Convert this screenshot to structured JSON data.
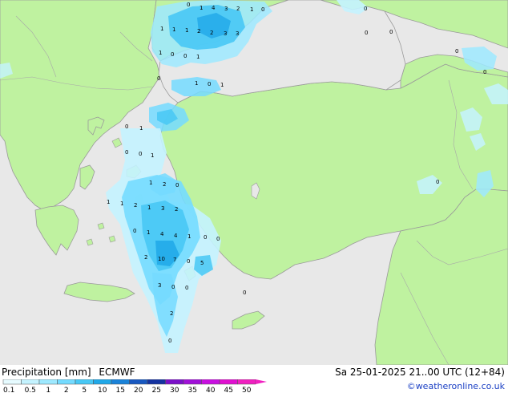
{
  "title": {
    "label": "Precipitation [mm]",
    "model": "ECMWF"
  },
  "valid_time": "Sa 25-01-2025 21..00 UTC (12+84)",
  "credit": "©weatheronline.co.uk",
  "legend": {
    "ticks": [
      "0.1",
      "0.5",
      "1",
      "2",
      "5",
      "10",
      "15",
      "20",
      "25",
      "30",
      "35",
      "40",
      "45",
      "50"
    ],
    "colors": [
      "#e6fbff",
      "#c4f3ff",
      "#9ee9ff",
      "#74dbff",
      "#48c8f5",
      "#20a8e8",
      "#1a82d8",
      "#1858c0",
      "#1432a0",
      "#7b10c8",
      "#a010d8",
      "#c810e0",
      "#e010d0",
      "#f020c0"
    ]
  },
  "colors": {
    "land": "#bff2a0",
    "sea": "#e8e8e8",
    "coast": "#9a9a9a",
    "border": "#a8a8a8"
  },
  "labels": [
    {
      "id": "v1",
      "text": "0"
    },
    {
      "id": "v2",
      "text": "1"
    },
    {
      "id": "v3",
      "text": "4"
    },
    {
      "id": "v4",
      "text": "3"
    },
    {
      "id": "v5",
      "text": "2"
    },
    {
      "id": "v6",
      "text": "1"
    },
    {
      "id": "v7",
      "text": "0"
    },
    {
      "id": "v8",
      "text": "1"
    },
    {
      "id": "v9",
      "text": "1"
    },
    {
      "id": "v10",
      "text": "1"
    },
    {
      "id": "v11",
      "text": "2"
    },
    {
      "id": "v12",
      "text": "2"
    },
    {
      "id": "v13",
      "text": "3"
    },
    {
      "id": "v14",
      "text": "3"
    },
    {
      "id": "v15",
      "text": "1"
    },
    {
      "id": "v16",
      "text": "0"
    },
    {
      "id": "v17",
      "text": "0"
    },
    {
      "id": "v18",
      "text": "1"
    },
    {
      "id": "v19",
      "text": "0"
    },
    {
      "id": "v20",
      "text": "1"
    },
    {
      "id": "v21",
      "text": "0"
    },
    {
      "id": "v22",
      "text": "1"
    },
    {
      "id": "v23",
      "text": "0"
    },
    {
      "id": "v24",
      "text": "1"
    },
    {
      "id": "v25",
      "text": "0"
    },
    {
      "id": "v26",
      "text": "0"
    },
    {
      "id": "v27",
      "text": "1"
    },
    {
      "id": "v28",
      "text": "1"
    },
    {
      "id": "v29",
      "text": "2"
    },
    {
      "id": "v30",
      "text": "0"
    },
    {
      "id": "v31",
      "text": "1"
    },
    {
      "id": "v32",
      "text": "1"
    },
    {
      "id": "v33",
      "text": "2"
    },
    {
      "id": "v34",
      "text": "1"
    },
    {
      "id": "v35",
      "text": "3"
    },
    {
      "id": "v36",
      "text": "2"
    },
    {
      "id": "v37",
      "text": "0"
    },
    {
      "id": "v38",
      "text": "1"
    },
    {
      "id": "v39",
      "text": "4"
    },
    {
      "id": "v40",
      "text": "4"
    },
    {
      "id": "v41",
      "text": "1"
    },
    {
      "id": "v42",
      "text": "0"
    },
    {
      "id": "v43",
      "text": "0"
    },
    {
      "id": "v44",
      "text": "2"
    },
    {
      "id": "v45",
      "text": "10"
    },
    {
      "id": "v46",
      "text": "7"
    },
    {
      "id": "v47",
      "text": "0"
    },
    {
      "id": "v48",
      "text": "5"
    },
    {
      "id": "v49",
      "text": "3"
    },
    {
      "id": "v50",
      "text": "0"
    },
    {
      "id": "v51",
      "text": "0"
    },
    {
      "id": "v52",
      "text": "0"
    },
    {
      "id": "v53",
      "text": "2"
    },
    {
      "id": "v54",
      "text": "0"
    },
    {
      "id": "v55",
      "text": "0"
    },
    {
      "id": "v56",
      "text": "0"
    },
    {
      "id": "v57",
      "text": "0"
    },
    {
      "id": "v58",
      "text": "0"
    },
    {
      "id": "v59",
      "text": "0"
    },
    {
      "id": "v60",
      "text": "0"
    }
  ]
}
